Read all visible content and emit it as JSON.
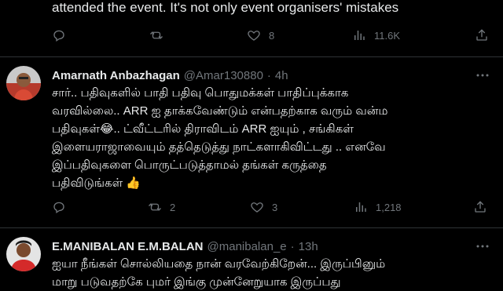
{
  "tweet_fragment": {
    "text": "attended the event. It's not only event organisers' mistakes",
    "actions": {
      "replies": "",
      "retweets": "",
      "likes": "8",
      "views": "11.6K"
    }
  },
  "tweets": [
    {
      "name": "Amarnath Anbazhagan",
      "handle": "@Amar130880",
      "dot": "·",
      "time": "4h",
      "lines": [
        "சார்.. பதிவுகளில் பாதி பதிவு பொதுமக்கள் பாதிப்புக்காக",
        "வரவில்லை.. ARR ஐ தாக்கவேண்டும் என்பதற்காக வரும் வன்ம",
        "பதிவுகள்😂.. ட்வீட்டரில் திராவிடம் ARR ஐயும் , சங்கிகள்",
        "இளையராஜாவையும் தத்தெடுத்து நாட்களாகிவிட்டது .. எனவே",
        "இப்பதிவுகளை பொருட்படுத்தாமல் தங்கள் கருத்தை",
        "பதிவிடுங்கள் 👍"
      ],
      "actions": {
        "replies": "",
        "retweets": "2",
        "likes": "3",
        "views": "1,218"
      }
    },
    {
      "name": "E.MANIBALAN E.M.BALAN",
      "handle": "@manibalan_e",
      "dot": "·",
      "time": "13h",
      "lines": [
        "ஐயா நீங்கள் சொல்லியதை நான் வரவேற்கிறேன்... இருப்பினும்",
        "மாறு படுவதற்கே புமர் இங்கு முன்னேறுயாக இருப்பது"
      ]
    }
  ],
  "icons": {
    "reply": "reply-icon",
    "retweet": "retweet-icon",
    "like": "heart-icon",
    "views": "views-icon",
    "share": "share-icon",
    "more": "more-icon"
  },
  "colors": {
    "background": "#000000",
    "text": "#e7e9ea",
    "muted": "#71767b",
    "divider": "#2f3336"
  }
}
